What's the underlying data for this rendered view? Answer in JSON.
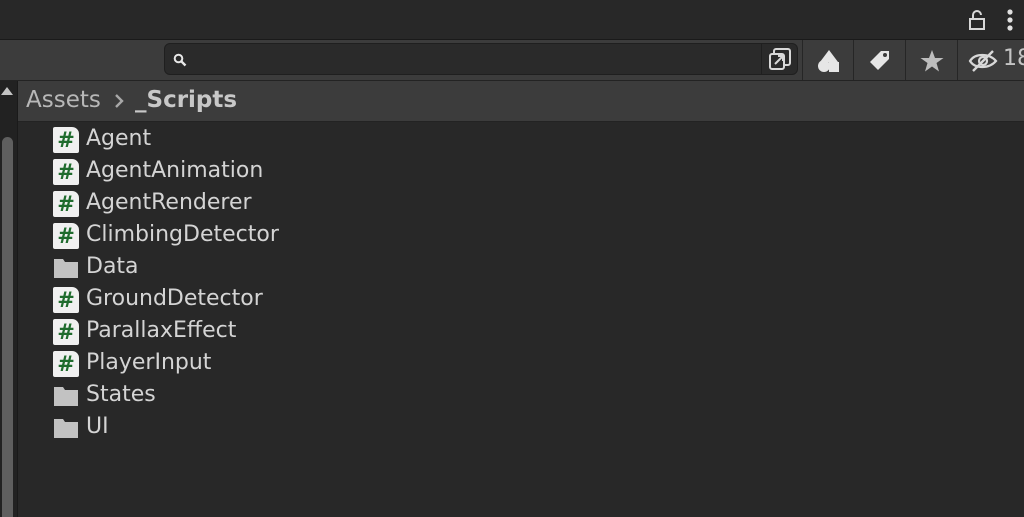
{
  "titlebar": {
    "lock_icon": "lock-icon",
    "menu_icon": "kebab-menu-icon"
  },
  "toolbar": {
    "search": {
      "placeholder": "",
      "value": ""
    },
    "buttons": [
      "search-by-type-icon",
      "search-by-label-icon",
      "favorites-star-icon",
      "hidden-packages-eye-icon"
    ],
    "hidden_count": "18"
  },
  "breadcrumb": {
    "root": "Assets",
    "current": "_Scripts"
  },
  "items": [
    {
      "name": "Agent",
      "icon": "csharp-script-icon"
    },
    {
      "name": "AgentAnimation",
      "icon": "csharp-script-icon"
    },
    {
      "name": "AgentRenderer",
      "icon": "csharp-script-icon"
    },
    {
      "name": "ClimbingDetector",
      "icon": "csharp-script-icon"
    },
    {
      "name": "Data",
      "icon": "folder-icon"
    },
    {
      "name": "GroundDetector",
      "icon": "csharp-script-icon"
    },
    {
      "name": "ParallaxEffect",
      "icon": "csharp-script-icon"
    },
    {
      "name": "PlayerInput",
      "icon": "csharp-script-icon"
    },
    {
      "name": "States",
      "icon": "folder-icon"
    },
    {
      "name": "UI",
      "icon": "folder-icon"
    }
  ],
  "colors": {
    "background": "#282828",
    "toolbar": "#3c3c3c",
    "script_hash": "#1f6b2d",
    "text": "#d4d4d4"
  }
}
